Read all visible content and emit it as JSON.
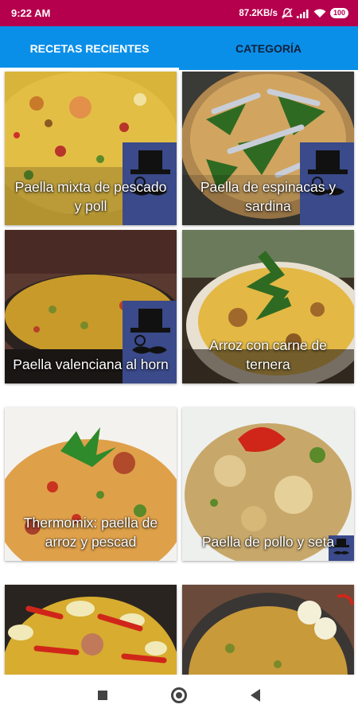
{
  "status_bar": {
    "time": "9:22 AM",
    "speed": "87.2KB/s",
    "battery": "100",
    "icons": [
      "mute-icon",
      "signal-icon",
      "wifi-icon",
      "battery-icon"
    ]
  },
  "tabs": [
    {
      "label": "RECETAS RECIENTES",
      "active": true
    },
    {
      "label": "CATEGORÍA",
      "active": false
    }
  ],
  "recipes": [
    {
      "title": "Paella mixta de pescado y poll",
      "badge": "large"
    },
    {
      "title": "Paella de espinacas y sardina",
      "badge": "large"
    },
    {
      "title": "Paella valenciana al horn",
      "badge": "large"
    },
    {
      "title": "Arroz con carne de ternera",
      "badge": "none"
    },
    {
      "title": "Thermomix: paella de arroz y pescad",
      "badge": "none"
    },
    {
      "title": "Paella de pollo y seta",
      "badge": "small"
    },
    {
      "title": "",
      "badge": "none"
    },
    {
      "title": "",
      "badge": "none"
    }
  ],
  "nav": [
    "recent-apps-button",
    "home-button",
    "back-button"
  ],
  "colors": {
    "status_bar": "#b5004d",
    "tab_bar": "#0a8fe8",
    "badge": "#3a4a8a"
  }
}
